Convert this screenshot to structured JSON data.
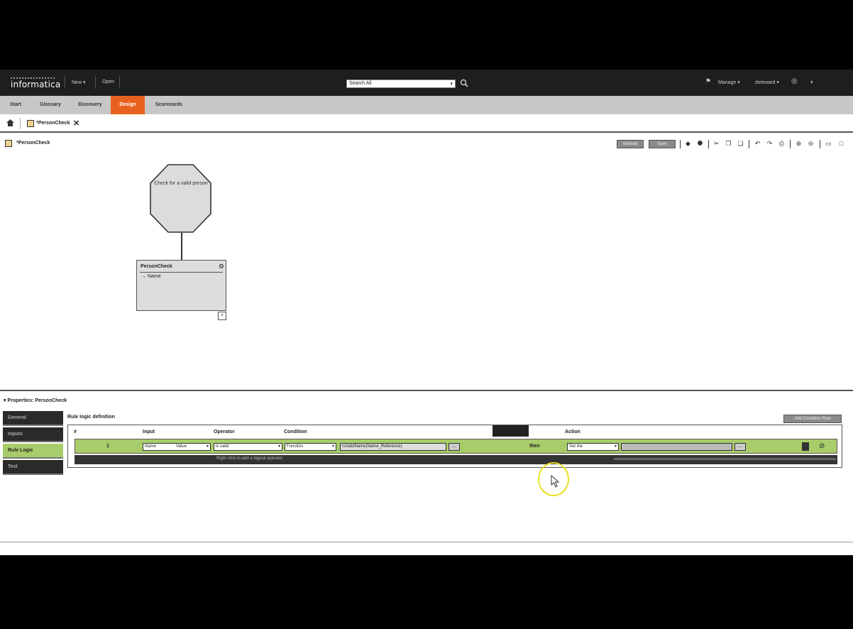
{
  "header": {
    "logo_text": "informatica",
    "new_label": "New",
    "open_label": "Open",
    "search_value": "Search All",
    "manage_label": "Manage",
    "user_label": "dsteward"
  },
  "module_tabs": [
    "Start",
    "Glossary",
    "Discovery",
    "Design",
    "Scorecards"
  ],
  "doc_tab": {
    "title": "*PersonCheck"
  },
  "canvas": {
    "title": "*PersonCheck",
    "buttons": [
      "Validate",
      "Save"
    ]
  },
  "diagram": {
    "decision_label": "Check for a valid person",
    "node_title": "PersonCheck",
    "node_port": "Name"
  },
  "properties": {
    "title": "Properties: PersonCheck",
    "tabs": [
      "General",
      "Inputs",
      "Rule Logic",
      "Test"
    ],
    "active_tab": "Rule Logic",
    "section_title": "Rule logic definition",
    "add_button": "Add Condition Row",
    "columns": {
      "num": "#",
      "input": "Input",
      "operator": "Operator",
      "condition": "Condition",
      "action": "Action"
    },
    "row": {
      "num": "1",
      "input_a": "Name",
      "input_b": "Value",
      "operator": "is valid",
      "condition": "Function",
      "expression": "IsValidName(Name_Reference)",
      "then_label": "then",
      "action": "Set the"
    },
    "row2_text": "Right click to add a logical operator"
  }
}
